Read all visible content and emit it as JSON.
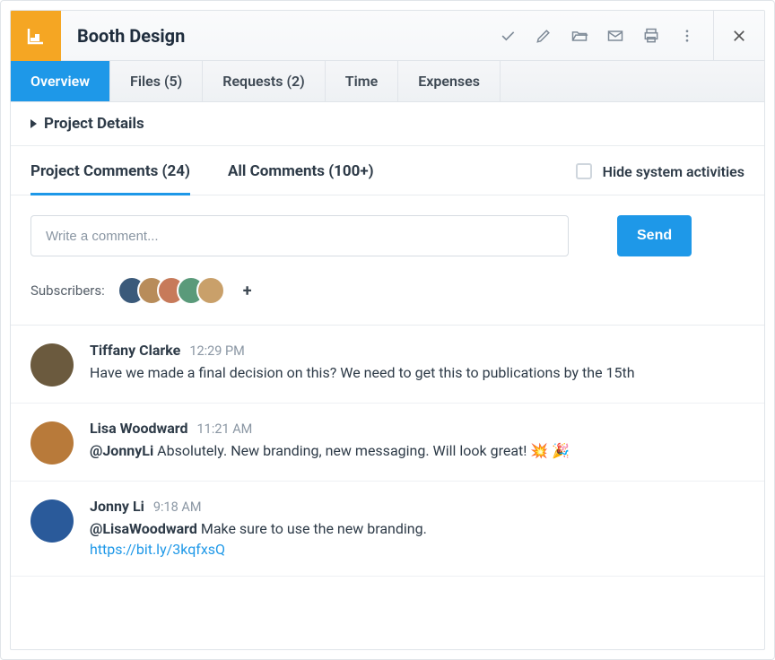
{
  "header": {
    "title": "Booth Design"
  },
  "tabs": [
    {
      "label": "Overview",
      "active": true
    },
    {
      "label": "Files (5)",
      "active": false
    },
    {
      "label": "Requests (2)",
      "active": false
    },
    {
      "label": "Time",
      "active": false
    },
    {
      "label": "Expenses",
      "active": false
    }
  ],
  "details": {
    "label": "Project Details"
  },
  "commentTabs": {
    "project": "Project Comments (24)",
    "all": "All Comments (100+)",
    "hideSystem": "Hide system activities"
  },
  "compose": {
    "placeholder": "Write a comment...",
    "send": "Send",
    "subscribersLabel": "Subscribers:",
    "subscriberCount": 5,
    "addLabel": "+"
  },
  "subscriberColors": [
    "#3b5a7a",
    "#b88c5a",
    "#c77a5a",
    "#5a9a7a",
    "#c9a06a"
  ],
  "comments": [
    {
      "author": "Tiffany Clarke",
      "time": "12:29 PM",
      "text": "Have we made a final decision on this? We need to get this to publications by the 15th",
      "avatarColor": "#6b5a3e"
    },
    {
      "author": "Lisa Woodward",
      "time": "11:21 AM",
      "mention": "@JonnyLi",
      "text": " Absolutely. New branding, new messaging. Will look great! 💥 🎉",
      "avatarColor": "#b87a3a"
    },
    {
      "author": "Jonny Li",
      "time": "9:18 AM",
      "mention": "@LisaWoodward",
      "text": " Make sure to use the new branding.",
      "link": "https://bit.ly/3kqfxsQ",
      "avatarColor": "#2a5a9a"
    }
  ]
}
